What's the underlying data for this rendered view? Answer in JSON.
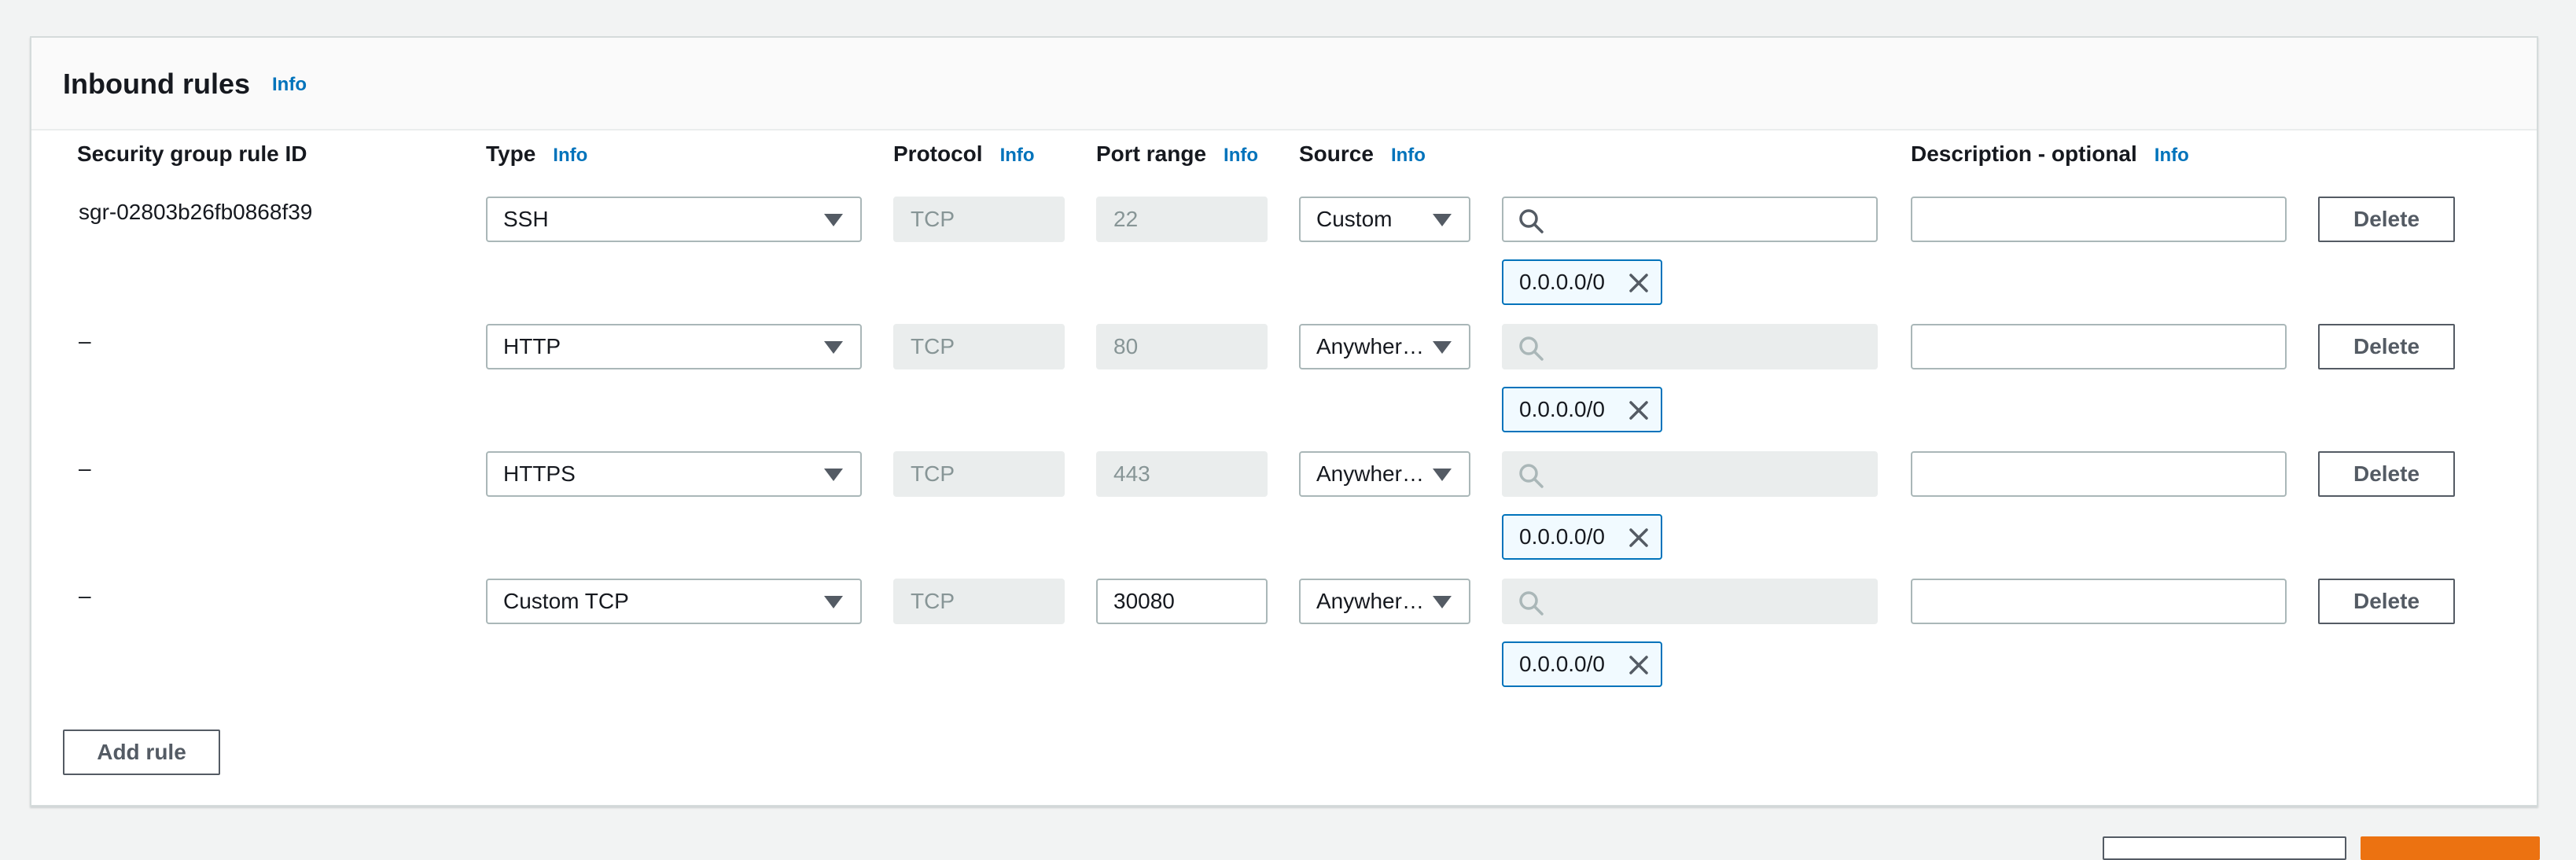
{
  "panel": {
    "title": "Inbound rules",
    "info": "Info"
  },
  "columns": {
    "rule_id": "Security group rule ID",
    "type": "Type",
    "protocol": "Protocol",
    "port_range": "Port range",
    "source": "Source",
    "description": "Description - optional",
    "info": "Info"
  },
  "rules": [
    {
      "id": "sgr-02803b26fb0868f39",
      "type": "SSH",
      "protocol": "TCP",
      "port": "22",
      "port_editable": false,
      "source": "Custom",
      "search_disabled": false,
      "cidr": "0.0.0.0/0",
      "description": ""
    },
    {
      "id": "–",
      "type": "HTTP",
      "protocol": "TCP",
      "port": "80",
      "port_editable": false,
      "source": "Anywher…",
      "search_disabled": true,
      "cidr": "0.0.0.0/0",
      "description": ""
    },
    {
      "id": "–",
      "type": "HTTPS",
      "protocol": "TCP",
      "port": "443",
      "port_editable": false,
      "source": "Anywher…",
      "search_disabled": true,
      "cidr": "0.0.0.0/0",
      "description": ""
    },
    {
      "id": "–",
      "type": "Custom TCP",
      "protocol": "TCP",
      "port": "30080",
      "port_editable": true,
      "source": "Anywher…",
      "search_disabled": true,
      "cidr": "0.0.0.0/0",
      "description": ""
    }
  ],
  "buttons": {
    "delete": "Delete",
    "add_rule": "Add rule"
  },
  "colors": {
    "info_link": "#0073bb",
    "token_border": "#0073bb",
    "primary_button": "#ec7211"
  },
  "icons": {
    "search": "search-icon",
    "remove": "close-icon",
    "dropdown": "caret-down-icon"
  }
}
